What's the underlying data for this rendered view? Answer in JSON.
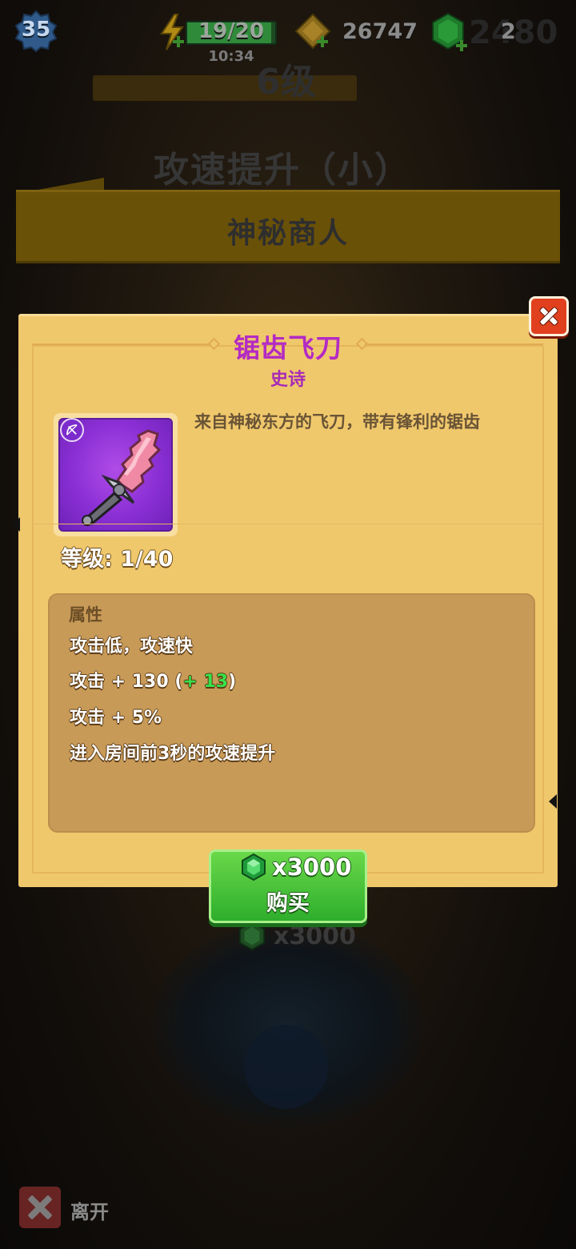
{
  "hud": {
    "player_level": "35",
    "energy": "19/20",
    "energy_fraction": 0.95,
    "energy_timer": "10:34",
    "gold": "26747",
    "gems": "2",
    "gems_ghost": "2480"
  },
  "background": {
    "level_label": "6级",
    "skill_label": "攻速提升（小）",
    "banner_title": "神秘商人",
    "price": "x3000"
  },
  "item": {
    "name": "锯齿飞刀",
    "rarity": "史诗",
    "description": "来自神秘东方的飞刀，带有锋利的锯齿",
    "level": "等级: 1/40",
    "rarity_color": "#b32bc4"
  },
  "attributes": {
    "title": "属性",
    "line1": "攻击低，攻速快",
    "line2_prefix": "攻击 + 130 (",
    "line2_bonus": "+ 13",
    "line2_suffix": ")",
    "line3": "攻击 + 5%",
    "line4": "进入房间前3秒的攻速提升"
  },
  "buy": {
    "price": "x3000",
    "label": "购买"
  },
  "footer": {
    "leave_label": "离开"
  },
  "icons": {
    "close": "close-icon",
    "gem": "gem-icon",
    "gold": "gold-icon",
    "energy": "energy-icon",
    "weapon": "saw-blade-knife-icon",
    "weapon_type": "bow-icon"
  }
}
